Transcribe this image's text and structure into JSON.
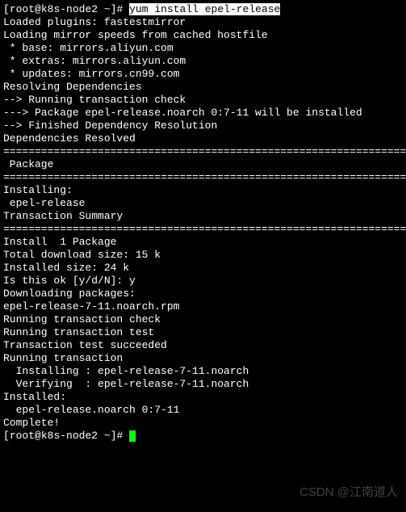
{
  "prompt": {
    "user": "root",
    "host": "k8s-node2",
    "path": "~",
    "symbol": "#"
  },
  "command": "yum install epel-release",
  "output": [
    "Loaded plugins: fastestmirror",
    "Loading mirror speeds from cached hostfile",
    " * base: mirrors.aliyun.com",
    " * extras: mirrors.aliyun.com",
    " * updates: mirrors.cn99.com",
    "Resolving Dependencies",
    "--> Running transaction check",
    "---> Package epel-release.noarch 0:7-11 will be installed",
    "--> Finished Dependency Resolution",
    "",
    "Dependencies Resolved",
    "",
    "================================================================",
    " Package",
    "================================================================",
    "Installing:",
    " epel-release",
    "",
    "Transaction Summary",
    "================================================================",
    "Install  1 Package",
    "",
    "Total download size: 15 k",
    "Installed size: 24 k",
    "Is this ok [y/d/N]: y",
    "Downloading packages:",
    "epel-release-7-11.noarch.rpm",
    "Running transaction check",
    "Running transaction test",
    "Transaction test succeeded",
    "Running transaction",
    "  Installing : epel-release-7-11.noarch",
    "  Verifying  : epel-release-7-11.noarch",
    "",
    "Installed:",
    "  epel-release.noarch 0:7-11",
    "",
    "Complete!"
  ],
  "watermark": "CSDN @江南道人"
}
